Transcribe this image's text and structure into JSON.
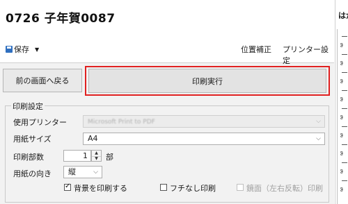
{
  "window": {
    "title": "0726 子年賀0087"
  },
  "toolbar": {
    "save_label": "保存",
    "dropdown_glyph": "▼",
    "position_correction": "位置補正",
    "printer_settings": "プリンター設定"
  },
  "actions": {
    "back_label": "前の画面へ戻る",
    "print_label": "印刷実行"
  },
  "print_settings": {
    "legend": "印刷設定",
    "printer_label": "使用プリンター",
    "printer_value": "Microsoft Print to PDF",
    "paper_size_label": "用紙サイズ",
    "paper_size_value": "A4",
    "copies_label": "印刷部数",
    "copies_value": "1",
    "copies_unit": "部",
    "orientation_label": "用紙の向き",
    "orientation_value": "縦",
    "print_background": {
      "label": "背景を印刷する",
      "checked": true
    },
    "borderless": {
      "label": "フチなし印刷",
      "checked": false
    },
    "mirror": {
      "label": "鏡面（左右反転）印刷",
      "checked": false,
      "disabled": true
    }
  },
  "right_panel": {
    "heading": "はが"
  },
  "colors": {
    "accent_red": "#e02020",
    "save_icon": "#2f6fbf"
  }
}
